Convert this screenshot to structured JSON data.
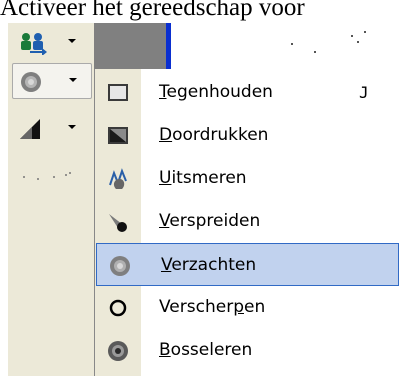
{
  "caption": "Activeer het gereedschap voor",
  "menu": {
    "items": [
      {
        "icon": "dodge-icon",
        "pre": "",
        "u": "T",
        "post": "egenhouden",
        "shortcut": "J"
      },
      {
        "icon": "burn-icon",
        "pre": "",
        "u": "D",
        "post": "oordrukken",
        "shortcut": ""
      },
      {
        "icon": "smudge-icon",
        "pre": "",
        "u": "U",
        "post": "itsmeren",
        "shortcut": ""
      },
      {
        "icon": "spread-icon",
        "pre": "",
        "u": "V",
        "post": "erspreiden",
        "shortcut": ""
      },
      {
        "icon": "soften-icon",
        "pre": "",
        "u": "V",
        "post": "erzachten",
        "shortcut": ""
      },
      {
        "icon": "sharpen-icon",
        "pre": "Verscher",
        "u": "p",
        "post": "en",
        "shortcut": ""
      },
      {
        "icon": "emboss-icon",
        "pre": "",
        "u": "B",
        "post": "osseleren",
        "shortcut": ""
      }
    ],
    "highlighted_index": 4
  },
  "toolbar": {
    "tools": [
      "clone-stamp-icon",
      "soften-icon",
      "sharpen-icon",
      "spray-icon"
    ],
    "selected_index": 1
  },
  "colors": {
    "highlight": "#c1d2ee",
    "highlight_border": "#316ac5",
    "toolbar_bg": "#ece9d8",
    "canvas_border": "#0a2fd0"
  }
}
